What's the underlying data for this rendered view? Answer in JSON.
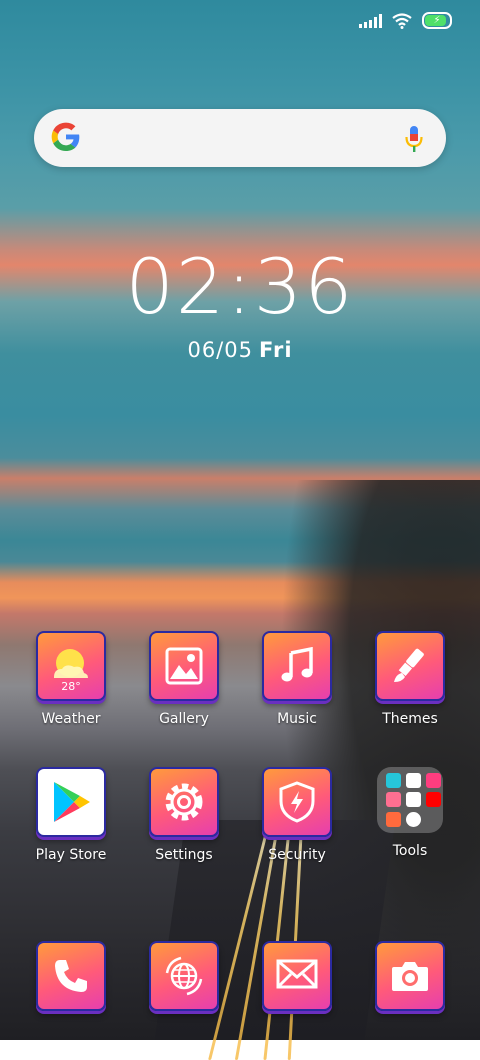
{
  "status_bar": {
    "icons": [
      "signal-icon",
      "wifi-icon",
      "battery-charging-icon"
    ],
    "battery_color": "#4fe06a"
  },
  "search": {
    "placeholder": ""
  },
  "clock": {
    "time": "02:36",
    "date": "06/05",
    "day": "Fri"
  },
  "apps": {
    "row1": [
      {
        "label": "Weather",
        "icon": "weather-icon",
        "temp": "28°"
      },
      {
        "label": "Gallery",
        "icon": "gallery-icon"
      },
      {
        "label": "Music",
        "icon": "music-icon"
      },
      {
        "label": "Themes",
        "icon": "themes-icon"
      }
    ],
    "row2": [
      {
        "label": "Play Store",
        "icon": "play-store-icon"
      },
      {
        "label": "Settings",
        "icon": "gear-icon"
      },
      {
        "label": "Security",
        "icon": "shield-icon"
      },
      {
        "label": "Tools",
        "icon": "folder-icon"
      }
    ],
    "dock": [
      {
        "icon": "phone-icon"
      },
      {
        "icon": "browser-icon"
      },
      {
        "icon": "messages-icon"
      },
      {
        "icon": "camera-icon"
      }
    ]
  },
  "colors": {
    "icon_gradient_start": "#ff9a3c",
    "icon_gradient_end": "#e63fae",
    "icon_border": "#2b2aa0"
  }
}
